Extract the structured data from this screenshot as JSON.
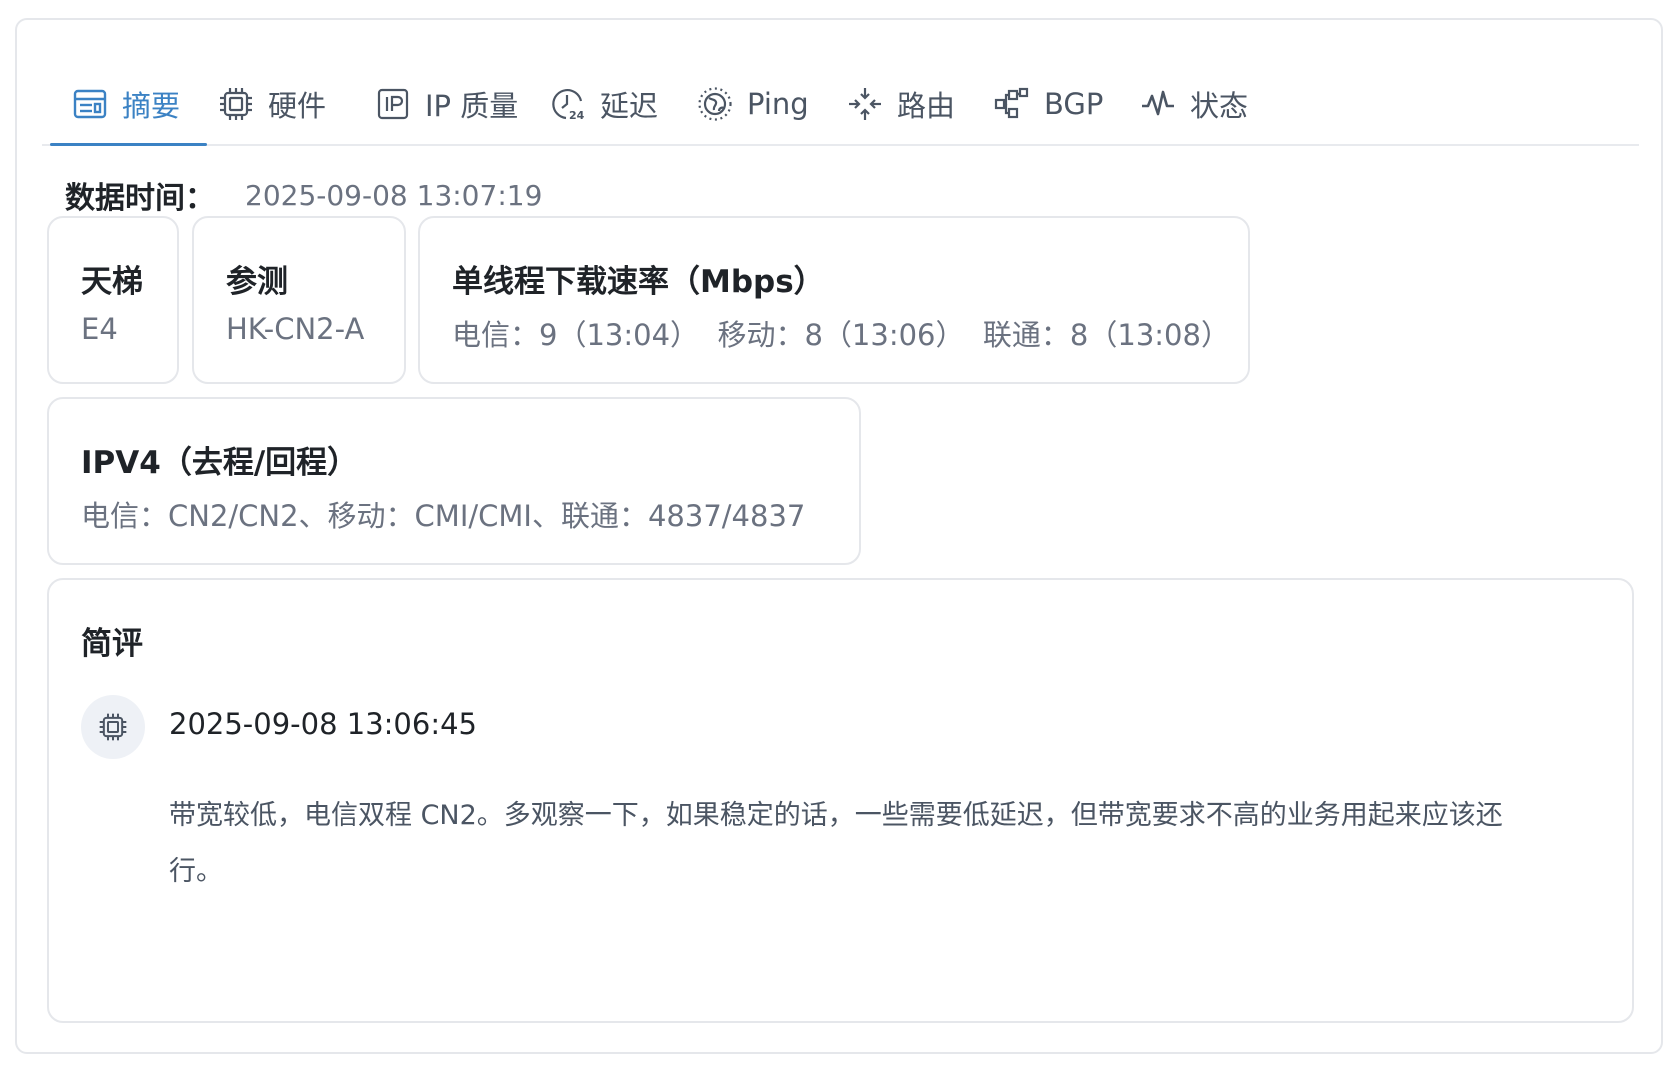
{
  "tabs": [
    {
      "label": "摘要",
      "icon": "summary-icon",
      "active": true
    },
    {
      "label": "硬件",
      "icon": "cpu-icon"
    },
    {
      "label": "IP 质量",
      "icon": "ip-icon"
    },
    {
      "label": "延迟",
      "icon": "clock-24-icon"
    },
    {
      "label": "Ping",
      "icon": "globe-icon"
    },
    {
      "label": "路由",
      "icon": "route-icon"
    },
    {
      "label": "BGP",
      "icon": "network-icon"
    },
    {
      "label": "状态",
      "icon": "pulse-icon"
    }
  ],
  "colors": {
    "accent": "#3b82c4",
    "border": "#e5e7eb",
    "muted": "#6b7280"
  },
  "data_time": {
    "label": "数据时间：",
    "value": "2025-09-08 13:07:19"
  },
  "cards": {
    "ladder": {
      "title": "天梯",
      "value": "E4"
    },
    "probe": {
      "title": "参测",
      "value": "HK-CN2-A"
    },
    "speed": {
      "title": "单线程下载速率（Mbps）",
      "value": "电信：9（13:04）  移动：8（13:06）  联通：8（13:08）"
    },
    "ipv4": {
      "title": "IPV4（去程/回程）",
      "value": "电信：CN2/CN2、移动：CMI/CMI、联通：4837/4837"
    }
  },
  "review": {
    "title": "简评",
    "avatar_icon": "cpu-icon",
    "time": "2025-09-08 13:06:45",
    "text": "带宽较低，电信双程 CN2。多观察一下，如果稳定的话，一些需要低延迟，但带宽要求不高的业务用起来应该还行。"
  }
}
